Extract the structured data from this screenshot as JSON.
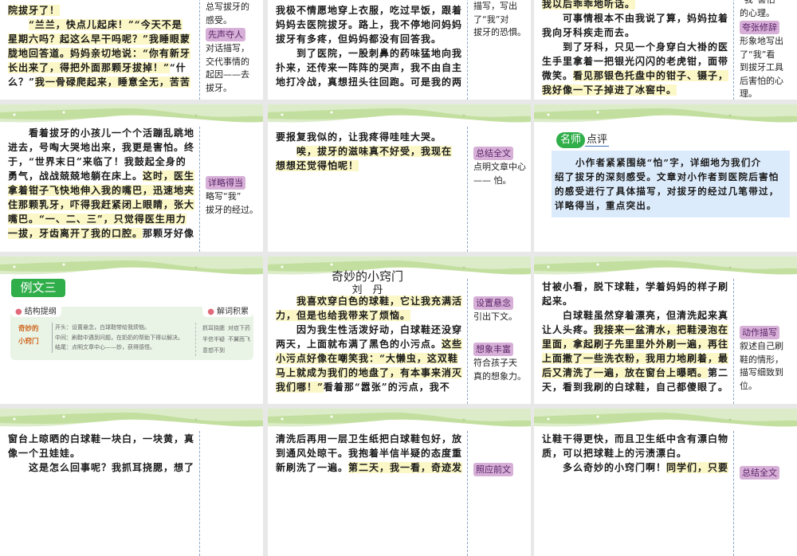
{
  "accent_green": "#2fae4a",
  "tag_color": "#d7b0d8",
  "highlight_color": "#fbf7c6",
  "slides": [
    {
      "lines": [
        {
          "s": [
            [
              "院拔牙了！",
              1
            ]
          ]
        },
        {
          "i": 1,
          "s": [
            [
              "“兰兰，快点儿起床！”“今天不是",
              1
            ]
          ]
        },
        {
          "s": [
            [
              "星期六吗？起这么早干吗呢？”我睡眼蒙",
              1
            ]
          ]
        },
        {
          "s": [
            [
              "胧地回答道。妈妈亲切地说：“你有新牙",
              1
            ]
          ]
        },
        {
          "s": [
            [
              "长出来了，得把外面那颗牙拔掉！”",
              1
            ],
            [
              "“什",
              0
            ]
          ]
        },
        {
          "s": [
            [
              "么？”",
              0
            ],
            [
              "我一骨碌爬起来，睡意全无，苦苦",
              1
            ]
          ]
        }
      ],
      "notes": [
        [
          "总写拔牙的",
          "感受。",
          {
            "tag": "先声夺人"
          },
          "对话描写，",
          "交代事情的",
          "起因——去",
          "拔牙。"
        ]
      ]
    },
    {
      "lines": [
        {
          "s": [
            [
              "我极不情愿地穿上衣服，吃过早饭，跟着",
              0
            ]
          ]
        },
        {
          "s": [
            [
              "妈妈去医院拔牙。路上，我不停地问妈妈",
              0
            ]
          ]
        },
        {
          "s": [
            [
              "拔牙有多疼，但妈妈都没有回答我。",
              0
            ]
          ]
        },
        {
          "i": 1,
          "s": [
            [
              "到了医院，一股刺鼻的药味猛地向我",
              0
            ]
          ]
        },
        {
          "s": [
            [
              "扑来，还传来一阵阵的哭声，我不由自主",
              0
            ]
          ]
        },
        {
          "s": [
            [
              "地打冷战，真想扭头往回跑。可是我的两",
              0
            ]
          ]
        }
      ],
      "notes": [
        [
          "描写，写出",
          "了“我”对",
          "拔牙的恐惧。"
        ]
      ]
    },
    {
      "lines": [
        {
          "s": [
            [
              "我以后乖乖地听话。",
              1
            ]
          ]
        },
        {
          "i": 1,
          "s": [
            [
              "可事情根本不由我说了算，妈妈拉着",
              0
            ]
          ]
        },
        {
          "s": [
            [
              "我向牙科疾走而去。",
              0
            ]
          ]
        },
        {
          "i": 1,
          "s": [
            [
              "到了牙科，只见一个身穿白大褂的医",
              0
            ]
          ]
        },
        {
          "s": [
            [
              "生手里拿着一把银光闪闪的老虎钳，面带",
              0
            ]
          ]
        },
        {
          "s": [
            [
              "微笑。",
              0
            ],
            [
              "看见那银色托盘中的钳子、镊子，",
              1
            ]
          ]
        },
        {
          "s": [
            [
              "我好像一下子掉进了冰窖中。",
              1
            ]
          ]
        }
      ],
      "notes": [
        [
          "“我”害怕",
          "的心理。",
          {
            "tag": "夸张修辞"
          },
          "形象地写出",
          "了“我”看",
          "到拔牙工具",
          "后害怕的心",
          "理。"
        ]
      ]
    },
    {
      "lines": [
        {
          "i": 1,
          "s": [
            [
              "看着拔牙的小孩儿一个个活蹦乱跳地",
              0
            ]
          ]
        },
        {
          "s": [
            [
              "进去，号啕大哭地出来，我更是害怕。终",
              0
            ]
          ]
        },
        {
          "s": [
            [
              "于，“世界末日”来临了！我鼓起全身的",
              0
            ]
          ]
        },
        {
          "s": [
            [
              "勇气，战战兢兢地躺在床上。",
              0
            ],
            [
              "这时，医生",
              1
            ]
          ]
        },
        {
          "s": [
            [
              "拿着钳子飞快地伸入我的嘴巴，迅速地夹",
              1
            ]
          ]
        },
        {
          "s": [
            [
              "住那颗乳牙，吓得我赶紧闭上眼睛，张大",
              1
            ]
          ]
        },
        {
          "s": [
            [
              "嘴巴。“一、二、三”，只觉得医生用力",
              1
            ]
          ]
        },
        {
          "s": [
            [
              "一拔，牙齿离开了我的口腔。",
              1
            ],
            [
              "那颗牙好像",
              0
            ]
          ]
        }
      ],
      "notes": [
        [
          {
            "tag": "详略得当"
          },
          "略写“我”",
          "拔牙的经过。"
        ]
      ]
    },
    {
      "lines": [
        {
          "s": [
            [
              "要报复我似的，让我疼得哇哇大哭。",
              0
            ]
          ]
        },
        {
          "i": 1,
          "s": [
            [
              "唉，拔牙的滋味真不好受，我现在",
              1
            ]
          ]
        },
        {
          "s": [
            [
              "想想还觉得怕呢！",
              1
            ]
          ]
        }
      ],
      "notes": [
        [
          {
            "tag": "总结全文"
          },
          "点明文章中心",
          "—— 怕。"
        ]
      ]
    },
    {
      "review": {
        "badge": "名师",
        "label": "点评",
        "lines": [
          {
            "i": 1,
            "s": [
              [
                "小作者紧紧围绕“怕”字，详细地为我们介",
                0
              ]
            ]
          },
          {
            "s": [
              [
                "绍了拔牙的深刻感受。文章对小作者到医院后害怕",
                0
              ]
            ]
          },
          {
            "s": [
              [
                "的感受进行了具体描写，对拔牙的经过几笔带过，",
                0
              ]
            ]
          },
          {
            "s": [
              [
                "详略得当，重点突出。",
                0
              ]
            ]
          }
        ]
      }
    },
    {
      "example": {
        "badge": "例文三",
        "structure_label": "结构提纲",
        "words_label": "解词积累",
        "center": [
          "奇妙的",
          "小窍门"
        ],
        "items": [
          "开头：设置悬念，白球鞋带给我烦恼。",
          "中间：刷鞋中遇到问题，在奶奶的帮助下得以解决。",
          "结尾：点明文章中心——妙，获得感悟。"
        ],
        "words": [
          "抓耳挠腮",
          "对症下药",
          "半信半疑",
          "不翼而飞",
          "意想不到"
        ]
      }
    },
    {
      "title": "奇妙的小窍门",
      "author": "刘　丹",
      "lines": [
        {
          "i": 1,
          "s": [
            [
              "我喜欢穿白色的球鞋，它让我充满活",
              1
            ]
          ]
        },
        {
          "s": [
            [
              "力，但是也给我带来了烦恼。",
              1
            ]
          ]
        },
        {
          "i": 1,
          "s": [
            [
              "因为我生性活泼好动，白球鞋还没穿",
              0
            ]
          ]
        },
        {
          "s": [
            [
              "两天，上面就布满了黑色的小污点。",
              0
            ],
            [
              "这些",
              1
            ]
          ]
        },
        {
          "s": [
            [
              "小污点好像在嘲笑我：“大懒虫，这双鞋",
              1
            ]
          ]
        },
        {
          "s": [
            [
              "马上就成为我们的地盘了，有本事来消灭",
              1
            ]
          ]
        },
        {
          "s": [
            [
              "我们哪！”",
              1
            ],
            [
              "看着那“嚣张”的污点，我不",
              0
            ]
          ]
        }
      ],
      "notes": [
        [
          {
            "tag": "设置悬念"
          },
          "引出下文。"
        ],
        [
          {
            "tag": "想象丰富"
          },
          "符合孩子天",
          "真的想象力。"
        ]
      ]
    },
    {
      "lines": [
        {
          "s": [
            [
              "甘被小看，脱下球鞋，学着妈妈的样子刷",
              0
            ]
          ]
        },
        {
          "s": [
            [
              "起来。",
              0
            ]
          ]
        },
        {
          "i": 1,
          "s": [
            [
              "白球鞋虽然穿着漂亮，但清洗起来真",
              0
            ]
          ]
        },
        {
          "s": [
            [
              "让人头疼。",
              0
            ],
            [
              "我接来一盆清水，把鞋浸泡在",
              1
            ]
          ]
        },
        {
          "s": [
            [
              "里面，拿起刷子先里里外外刷一遍，再往",
              1
            ]
          ]
        },
        {
          "s": [
            [
              "上面撒了一些洗衣粉，我用力地刷着，最",
              1
            ]
          ]
        },
        {
          "s": [
            [
              "后又清洗了一遍，放在窗台上曝晒。",
              1
            ],
            [
              "第二",
              0
            ]
          ]
        },
        {
          "s": [
            [
              "天，看到我刷的白球鞋，自己都傻眼了。",
              0
            ]
          ]
        }
      ],
      "notes": [
        [
          {
            "tag": "动作描写"
          },
          "叙述自己刷",
          "鞋的情形，",
          "描写细致到",
          "位。"
        ]
      ]
    },
    {
      "lines": [
        {
          "s": [
            [
              "窗台上晾晒的白球鞋一块白，一块黄，真",
              0
            ]
          ]
        },
        {
          "s": [
            [
              "像一个丑娃娃。",
              0
            ]
          ]
        },
        {
          "i": 1,
          "s": [
            [
              "这是怎么回事呢？我抓耳挠腮，想了",
              0
            ]
          ]
        }
      ],
      "notes": []
    },
    {
      "lines": [
        {
          "s": [
            [
              "清洗后再用一层卫生纸把白球鞋包好，放",
              0
            ]
          ]
        },
        {
          "s": [
            [
              "到通风处晾干。我抱着半信半疑的态度重",
              0
            ]
          ]
        },
        {
          "s": [
            [
              "新刷洗了一遍。",
              0
            ],
            [
              "第二天，我一看，奇迹发",
              1
            ]
          ]
        }
      ],
      "notes": [
        [
          {
            "tag": "照应前文"
          }
        ]
      ]
    },
    {
      "lines": [
        {
          "s": [
            [
              "让鞋干得更快，而且卫生纸中含有漂白物",
              0
            ]
          ]
        },
        {
          "s": [
            [
              "质，可以把球鞋上的污渍漂白。",
              0
            ]
          ]
        },
        {
          "i": 1,
          "s": [
            [
              "多么奇妙的小窍门啊！",
              0
            ],
            [
              "同学们，只要",
              1
            ]
          ]
        }
      ],
      "notes": [
        [
          {
            "tag": "总结全文"
          }
        ]
      ]
    }
  ]
}
